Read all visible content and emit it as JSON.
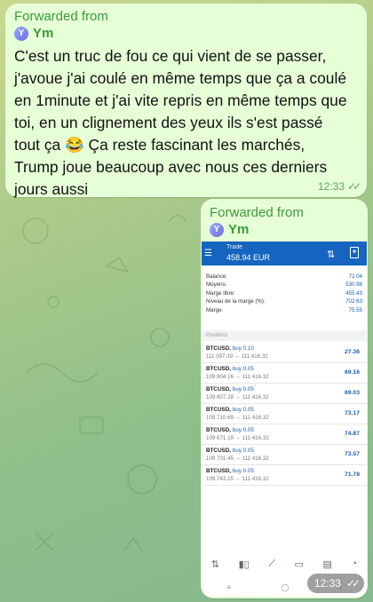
{
  "message1": {
    "forwarded_label": "Forwarded from",
    "sender_initial": "Y",
    "sender_name": "Ym",
    "lines": [
      "C'est un truc de fou ce qui vient de se passer,",
      "j'avoue j'ai coulé en même temps que ça a coulé",
      "en 1minute et j'ai vite repris en même temps que",
      "toi, en un clignement des yeux ils s'est passé",
      "tout ça 😂 Ça reste fascinant les marchés,",
      "Trump joue beaucoup avec nous ces derniers",
      "jours aussi"
    ],
    "time": "12:33",
    "ticks": "✓✓"
  },
  "message2": {
    "forwarded_label": "Forwarded from",
    "sender_initial": "Y",
    "sender_name": "Ym",
    "time": "12:33",
    "ticks": "✓✓"
  },
  "trade_app": {
    "title": "Trade",
    "balance_header": "458.94 EUR",
    "summary": [
      {
        "label": "Balance:",
        "value": "72.04"
      },
      {
        "label": "Moyens:",
        "value": "530.98"
      },
      {
        "label": "Marge libre:",
        "value": "455.43"
      },
      {
        "label": "Niveau de la marge (%):",
        "value": "702.63"
      },
      {
        "label": "Marge:",
        "value": "75.55"
      }
    ],
    "positions_label": "Positions",
    "positions": [
      {
        "symbol": "BTCUSD,",
        "side": "buy 0.10",
        "prices": "111 097.39 → 111 416.32",
        "profit": "27.36"
      },
      {
        "symbol": "BTCUSD,",
        "side": "buy 0.05",
        "prices": "109 804.16 → 111 416.32",
        "profit": "69.16"
      },
      {
        "symbol": "BTCUSD,",
        "side": "buy 0.05",
        "prices": "109 807.28 → 111 416.32",
        "profit": "69.03"
      },
      {
        "symbol": "BTCUSD,",
        "side": "buy 0.05",
        "prices": "109 710.69 → 111 416.32",
        "profit": "73.17"
      },
      {
        "symbol": "BTCUSD,",
        "side": "buy 0.05",
        "prices": "109 671.19 → 111 416.32",
        "profit": "74.87"
      },
      {
        "symbol": "BTCUSD,",
        "side": "buy 0.05",
        "prices": "109 701.45 → 111 416.32",
        "profit": "73.57"
      },
      {
        "symbol": "BTCUSD,",
        "side": "buy 0.05",
        "prices": "109 743.15 → 111 416.32",
        "profit": "71.78"
      }
    ],
    "tabs": [
      "quotes-icon",
      "chart-icon",
      "trade-icon",
      "history-icon",
      "news-icon",
      "chat-icon"
    ]
  },
  "colors": {
    "bubble": "#e6ffd7",
    "accent": "#3c9a3a",
    "app_bar": "#1565c0",
    "profit": "#1a5fb4"
  }
}
